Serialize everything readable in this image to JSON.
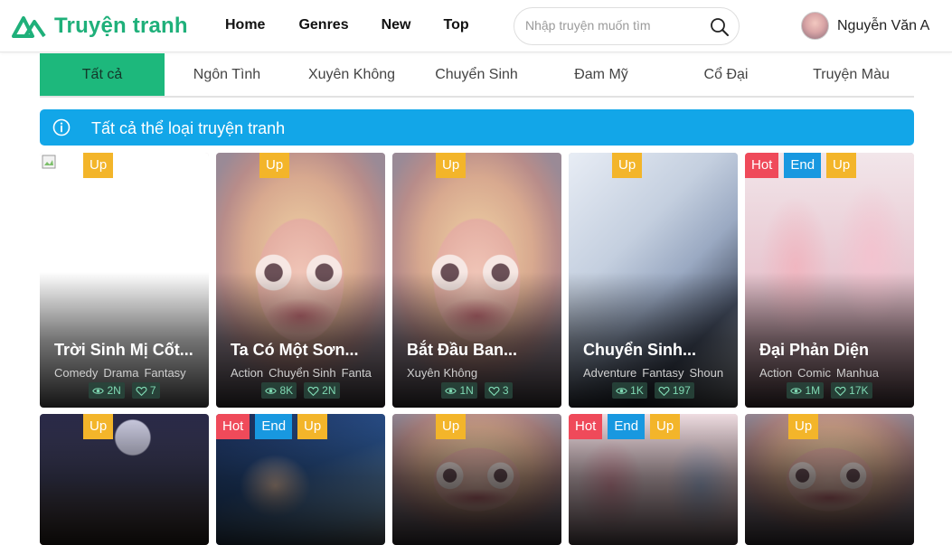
{
  "brand": {
    "name": "Truyện tranh",
    "color": "#1fb07a"
  },
  "nav": [
    "Home",
    "Genres",
    "New",
    "Top"
  ],
  "search": {
    "placeholder": "Nhập truyện muốn tìm"
  },
  "user": {
    "name": "Nguyễn Văn A"
  },
  "tabs": [
    "Tất cả",
    "Ngôn Tình",
    "Xuyên Không",
    "Chuyển Sinh",
    "Đam Mỹ",
    "Cổ Đại",
    "Truyện Màu"
  ],
  "active_tab": 0,
  "info": {
    "text": "Tất cả thể loại truyện tranh",
    "color": "#12a6e8"
  },
  "cards": [
    {
      "title": "Trời Sinh Mị Cốt...",
      "genres": [
        "Comedy",
        "Drama",
        "Fantasy"
      ],
      "views": "2N",
      "likes": "7",
      "badges": [
        "Up"
      ],
      "cover": "blank"
    },
    {
      "title": "Ta Có Một Sơn...",
      "genres": [
        "Action",
        "Chuyển Sinh",
        "Fanta"
      ],
      "views": "8K",
      "likes": "2N",
      "badges": [
        "Up"
      ],
      "cover": "portrait"
    },
    {
      "title": "Bắt Đầu Ban...",
      "genres": [
        "Xuyên Không"
      ],
      "views": "1N",
      "likes": "3",
      "badges": [
        "Up"
      ],
      "cover": "portrait"
    },
    {
      "title": "Chuyển Sinh...",
      "genres": [
        "Adventure",
        "Fantasy",
        "Shoun"
      ],
      "views": "1K",
      "likes": "197",
      "badges": [
        "Up"
      ],
      "cover": "manga"
    },
    {
      "title": "Đại Phản Diện",
      "genres": [
        "Action",
        "Comic",
        "Manhua"
      ],
      "views": "1M",
      "likes": "17K",
      "badges": [
        "Hot",
        "End",
        "Up"
      ],
      "cover": "couple"
    },
    {
      "title": "",
      "genres": [],
      "views": "",
      "likes": "",
      "badges": [
        "Up"
      ],
      "cover": "dark"
    },
    {
      "title": "",
      "genres": [],
      "views": "",
      "likes": "",
      "badges": [
        "Hot",
        "End",
        "Up"
      ],
      "cover": "blue"
    },
    {
      "title": "",
      "genres": [],
      "views": "",
      "likes": "",
      "badges": [
        "Up"
      ],
      "cover": "portrait"
    },
    {
      "title": "",
      "genres": [],
      "views": "",
      "likes": "",
      "badges": [
        "Hot",
        "End",
        "Up"
      ],
      "cover": "pinkblue"
    },
    {
      "title": "",
      "genres": [],
      "views": "",
      "likes": "",
      "badges": [
        "Up"
      ],
      "cover": "portrait"
    }
  ]
}
